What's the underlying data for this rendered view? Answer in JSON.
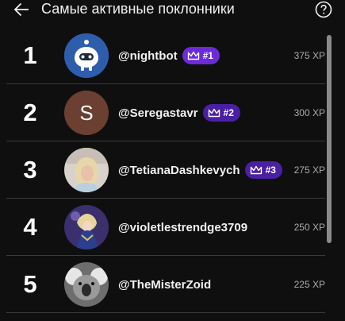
{
  "header": {
    "title": "Самые активные поклонники",
    "back_icon": "arrow-left-icon",
    "help_icon": "question-circle-icon"
  },
  "colors": {
    "background": "#0f0f0f",
    "badge_purple": "#6c2bd9",
    "badge_dark_purple": "#4a1fa6",
    "avatar_s_bg": "#6b3f31"
  },
  "fans": [
    {
      "rank": "1",
      "username": "@nightbot",
      "badge": "#1",
      "xp": "375 XP",
      "avatar": "nightbot-robot-avatar"
    },
    {
      "rank": "2",
      "username": "@Seregastavr",
      "badge": "#2",
      "xp": "300 XP",
      "avatar": "letter-avatar",
      "initial": "S"
    },
    {
      "rank": "3",
      "username": "@TetianaDashkevych",
      "badge": "#3",
      "xp": "275 XP",
      "avatar": "photo-avatar-blonde-woman"
    },
    {
      "rank": "4",
      "username": "@violetlestrendge3709",
      "xp": "250 XP",
      "avatar": "anime-character-avatar"
    },
    {
      "rank": "5",
      "username": "@TheMisterZoid",
      "xp": "225 XP",
      "avatar": "koala-photo-avatar"
    }
  ]
}
